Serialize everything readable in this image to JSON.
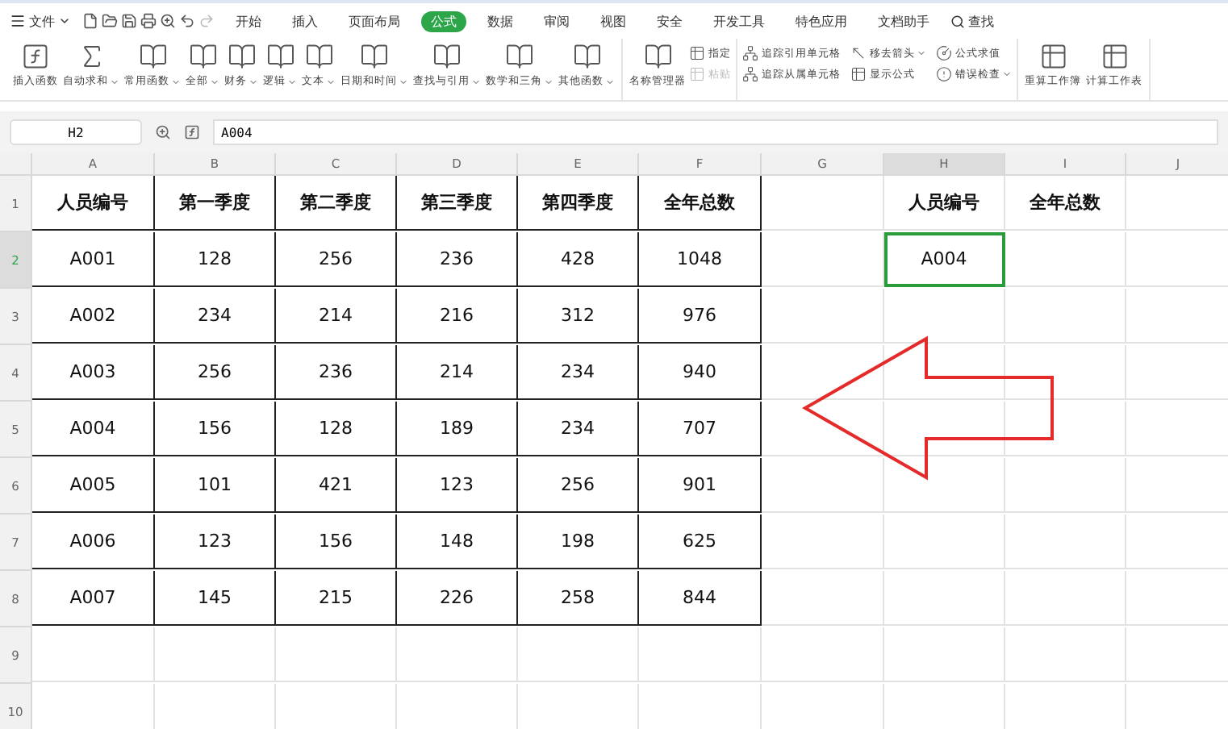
{
  "menu": {
    "file": "文件",
    "tabs": [
      {
        "label": "开始",
        "selected": false
      },
      {
        "label": "插入",
        "selected": false
      },
      {
        "label": "页面布局",
        "selected": false
      },
      {
        "label": "公式",
        "selected": true
      },
      {
        "label": "数据",
        "selected": false
      },
      {
        "label": "审阅",
        "selected": false
      },
      {
        "label": "视图",
        "selected": false
      },
      {
        "label": "安全",
        "selected": false
      },
      {
        "label": "开发工具",
        "selected": false
      },
      {
        "label": "特色应用",
        "selected": false
      },
      {
        "label": "文档助手",
        "selected": false
      }
    ],
    "search": "查找"
  },
  "ribbon": {
    "groups": [
      {
        "items": [
          {
            "kind": "big",
            "label": "插入函数",
            "dropdown": false,
            "disabled": false
          },
          {
            "kind": "big",
            "label": "自动求和",
            "dropdown": true,
            "disabled": false
          },
          {
            "kind": "big",
            "label": "常用函数",
            "dropdown": true,
            "disabled": false
          },
          {
            "kind": "big",
            "label": "全部",
            "dropdown": true,
            "disabled": false
          },
          {
            "kind": "big",
            "label": "财务",
            "dropdown": true,
            "disabled": false
          },
          {
            "kind": "big",
            "label": "逻辑",
            "dropdown": true,
            "disabled": false
          },
          {
            "kind": "big",
            "label": "文本",
            "dropdown": true,
            "disabled": false
          },
          {
            "kind": "big",
            "label": "日期和时间",
            "dropdown": true,
            "disabled": false
          },
          {
            "kind": "big",
            "label": "查找与引用",
            "dropdown": true,
            "disabled": false
          },
          {
            "kind": "big",
            "label": "数学和三角",
            "dropdown": true,
            "disabled": false
          },
          {
            "kind": "big",
            "label": "其他函数",
            "dropdown": true,
            "disabled": false
          }
        ]
      },
      {
        "items": [
          {
            "kind": "big",
            "label": "名称管理器",
            "dropdown": false,
            "disabled": false
          },
          {
            "kind": "small",
            "label": "指定",
            "dropdown": false,
            "disabled": false
          },
          {
            "kind": "small",
            "label": "粘贴",
            "dropdown": false,
            "disabled": true
          }
        ]
      },
      {
        "items": [
          {
            "kind": "small",
            "label": "追踪引用单元格",
            "dropdown": false,
            "disabled": false
          },
          {
            "kind": "small",
            "label": "追踪从属单元格",
            "dropdown": false,
            "disabled": false
          },
          {
            "kind": "small",
            "label": "移去箭头",
            "dropdown": true,
            "disabled": false
          },
          {
            "kind": "small",
            "label": "显示公式",
            "dropdown": false,
            "disabled": false
          },
          {
            "kind": "small",
            "label": "公式求值",
            "dropdown": false,
            "disabled": false
          },
          {
            "kind": "small",
            "label": "错误检查",
            "dropdown": true,
            "disabled": false
          }
        ]
      },
      {
        "items": [
          {
            "kind": "big",
            "label": "重算工作簿",
            "dropdown": false,
            "disabled": false
          },
          {
            "kind": "big",
            "label": "计算工作表",
            "dropdown": false,
            "disabled": false
          }
        ]
      }
    ]
  },
  "formula_bar": {
    "name_box": "H2",
    "value": "A004"
  },
  "sheet": {
    "columns": [
      "A",
      "B",
      "C",
      "D",
      "E",
      "F",
      "G",
      "H",
      "I",
      "J"
    ],
    "rows": [
      {
        "number": "1",
        "cells": [
          {
            "kind": "header",
            "text": "人员编号",
            "selected": false
          },
          {
            "kind": "header",
            "text": "第一季度",
            "selected": false
          },
          {
            "kind": "header",
            "text": "第二季度",
            "selected": false
          },
          {
            "kind": "header",
            "text": "第三季度",
            "selected": false
          },
          {
            "kind": "header",
            "text": "第四季度",
            "selected": false
          },
          {
            "kind": "header",
            "text": "全年总数",
            "selected": false
          },
          {
            "kind": "empty",
            "selected": false
          },
          {
            "kind": "label",
            "text": "人员编号",
            "selected": false
          },
          {
            "kind": "label",
            "text": "全年总数",
            "selected": false
          }
        ]
      },
      {
        "number": "2",
        "cells": [
          {
            "kind": "data",
            "text": "A001",
            "selected": false
          },
          {
            "kind": "data",
            "text": "128",
            "selected": false
          },
          {
            "kind": "data",
            "text": "256",
            "selected": false
          },
          {
            "kind": "data",
            "text": "236",
            "selected": false
          },
          {
            "kind": "data",
            "text": "428",
            "selected": false
          },
          {
            "kind": "data",
            "text": "1048",
            "selected": false
          },
          {
            "kind": "empty",
            "selected": false
          },
          {
            "kind": "value",
            "text": "A004",
            "selected": true
          }
        ]
      },
      {
        "number": "3",
        "cells": [
          {
            "kind": "data",
            "text": "A002",
            "selected": false
          },
          {
            "kind": "data",
            "text": "234",
            "selected": false
          },
          {
            "kind": "data",
            "text": "214",
            "selected": false
          },
          {
            "kind": "data",
            "text": "216",
            "selected": false
          },
          {
            "kind": "data",
            "text": "312",
            "selected": false
          },
          {
            "kind": "data",
            "text": "976",
            "selected": false
          }
        ]
      },
      {
        "number": "4",
        "cells": [
          {
            "kind": "data",
            "text": "A003",
            "selected": false
          },
          {
            "kind": "data",
            "text": "256",
            "selected": false
          },
          {
            "kind": "data",
            "text": "236",
            "selected": false
          },
          {
            "kind": "data",
            "text": "214",
            "selected": false
          },
          {
            "kind": "data",
            "text": "234",
            "selected": false
          },
          {
            "kind": "data",
            "text": "940",
            "selected": false
          }
        ]
      },
      {
        "number": "5",
        "cells": [
          {
            "kind": "data",
            "text": "A004",
            "selected": false
          },
          {
            "kind": "data",
            "text": "156",
            "selected": false
          },
          {
            "kind": "data",
            "text": "128",
            "selected": false
          },
          {
            "kind": "data",
            "text": "189",
            "selected": false
          },
          {
            "kind": "data",
            "text": "234",
            "selected": false
          },
          {
            "kind": "data",
            "text": "707",
            "selected": false
          }
        ]
      },
      {
        "number": "6",
        "cells": [
          {
            "kind": "data",
            "text": "A005",
            "selected": false
          },
          {
            "kind": "data",
            "text": "101",
            "selected": false
          },
          {
            "kind": "data",
            "text": "421",
            "selected": false
          },
          {
            "kind": "data",
            "text": "123",
            "selected": false
          },
          {
            "kind": "data",
            "text": "256",
            "selected": false
          },
          {
            "kind": "data",
            "text": "901",
            "selected": false
          }
        ]
      },
      {
        "number": "7",
        "cells": [
          {
            "kind": "data",
            "text": "A006",
            "selected": false
          },
          {
            "kind": "data",
            "text": "123",
            "selected": false
          },
          {
            "kind": "data",
            "text": "156",
            "selected": false
          },
          {
            "kind": "data",
            "text": "148",
            "selected": false
          },
          {
            "kind": "data",
            "text": "198",
            "selected": false
          },
          {
            "kind": "data",
            "text": "625",
            "selected": false
          }
        ]
      },
      {
        "number": "8",
        "cells": [
          {
            "kind": "data",
            "text": "A007",
            "selected": false
          },
          {
            "kind": "data",
            "text": "145",
            "selected": false
          },
          {
            "kind": "data",
            "text": "215",
            "selected": false
          },
          {
            "kind": "data",
            "text": "226",
            "selected": false
          },
          {
            "kind": "data",
            "text": "258",
            "selected": false
          },
          {
            "kind": "data",
            "text": "844",
            "selected": false
          }
        ]
      },
      {
        "number": "9",
        "cells": []
      },
      {
        "number": "10",
        "cells": []
      }
    ]
  }
}
